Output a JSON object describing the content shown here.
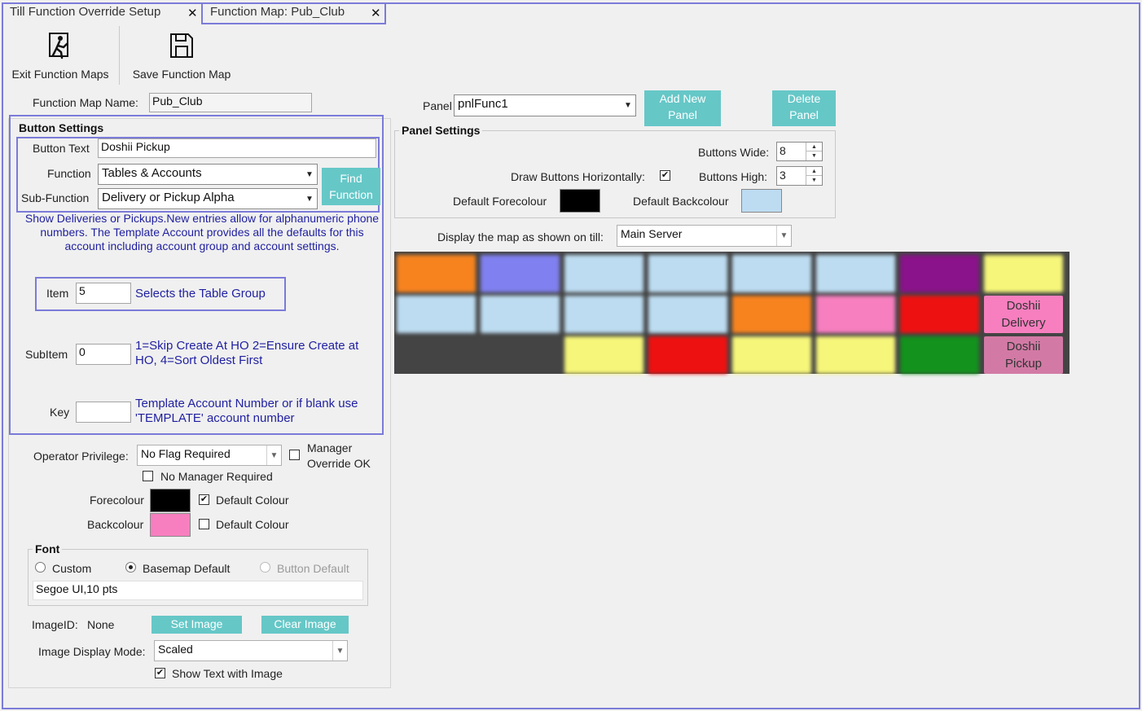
{
  "tabs": [
    {
      "label": "Till Function Override Setup",
      "close": "✕"
    },
    {
      "label": "Function Map: Pub_Club",
      "close": "✕"
    }
  ],
  "toolbar": {
    "exit_label": "Exit Function Maps",
    "save_label": "Save Function Map"
  },
  "function_map": {
    "name_label": "Function Map Name:",
    "name_value": "Pub_Club"
  },
  "button_settings": {
    "title": "Button Settings",
    "button_text_label": "Button Text",
    "button_text_value": "Doshii Pickup",
    "function_label": "Function",
    "function_value": "Tables & Accounts",
    "subfunction_label": "Sub-Function",
    "subfunction_value": "Delivery or Pickup Alpha",
    "find_function_label": "Find Function",
    "description": "Show Deliveries or Pickups.New entries allow for alphanumeric phone numbers. The Template Account provides all the defaults for this account including account group and account settings.",
    "item_label": "Item",
    "item_value": "5",
    "item_hint": "Selects the Table Group",
    "subitem_label": "SubItem",
    "subitem_value": "0",
    "subitem_hint": "1=Skip Create At HO 2=Ensure Create at HO, 4=Sort Oldest First",
    "key_label": "Key",
    "key_value": "",
    "key_hint": "Template Account Number or if blank use 'TEMPLATE' account number"
  },
  "privilege": {
    "operator_label": "Operator Privilege:",
    "operator_value": "No Flag Required",
    "manager_override_label": "Manager Override OK",
    "manager_override_checked": false,
    "no_manager_label": "No Manager Required",
    "no_manager_checked": false
  },
  "colours": {
    "fore_label": "Forecolour",
    "fore_color": "#000000",
    "fore_default_label": "Default Colour",
    "fore_default_checked": true,
    "back_label": "Backcolour",
    "back_color": "#f77fbf",
    "back_default_label": "Default Colour",
    "back_default_checked": false
  },
  "font": {
    "title": "Font",
    "options": [
      "Custom",
      "Basemap Default",
      "Button Default"
    ],
    "selected": "Basemap Default",
    "value": "Segoe UI,10 pts"
  },
  "image": {
    "id_label": "ImageID:",
    "id_value": "None",
    "set_label": "Set Image",
    "clear_label": "Clear Image",
    "display_mode_label": "Image Display Mode:",
    "display_mode_value": "Scaled",
    "show_text_label": "Show Text with Image",
    "show_text_checked": true
  },
  "panel": {
    "label": "Panel",
    "value": "pnlFunc1",
    "add_label": "Add New Panel",
    "delete_label": "Delete Panel"
  },
  "panel_settings": {
    "title": "Panel Settings",
    "buttons_wide_label": "Buttons Wide:",
    "buttons_wide_value": "8",
    "draw_horizontal_label": "Draw Buttons Horizontally:",
    "draw_horizontal_checked": true,
    "buttons_high_label": "Buttons High:",
    "buttons_high_value": "3",
    "default_fore_label": "Default Forecolour",
    "default_fore_color": "#000000",
    "default_back_label": "Default Backcolour",
    "default_back_color": "#bddcf1"
  },
  "display_map": {
    "label": "Display the map as shown on till:",
    "value": "Main Server"
  },
  "map_buttons": [
    [
      {
        "color": "#f7831f",
        "blurred": true
      },
      {
        "color": "#8080f0",
        "blurred": true
      },
      {
        "color": "#bddcf1",
        "blurred": true
      },
      {
        "color": "#bddcf1",
        "blurred": true
      },
      {
        "color": "#bddcf1",
        "blurred": true
      },
      {
        "color": "#bddcf1",
        "blurred": true
      },
      {
        "color": "#8a128a",
        "blurred": true
      },
      {
        "color": "#f6f67a",
        "blurred": true
      }
    ],
    [
      {
        "color": "#bddcf1",
        "blurred": true
      },
      {
        "color": "#bddcf1",
        "blurred": true
      },
      {
        "color": "#bddcf1",
        "blurred": true
      },
      {
        "color": "#bddcf1",
        "blurred": true
      },
      {
        "color": "#f7831f",
        "blurred": true
      },
      {
        "color": "#f77fbf",
        "blurred": true
      },
      {
        "color": "#ee1111",
        "blurred": true
      },
      {
        "color": "#f77fbf",
        "blurred": false,
        "label": "Doshii Delivery"
      }
    ],
    [
      {
        "color": "#444444",
        "blurred": false,
        "empty": true
      },
      {
        "color": "#444444",
        "blurred": false,
        "empty": true
      },
      {
        "color": "#f6f67a",
        "blurred": true
      },
      {
        "color": "#ee1111",
        "blurred": true
      },
      {
        "color": "#f6f67a",
        "blurred": true
      },
      {
        "color": "#f6f67a",
        "blurred": true
      },
      {
        "color": "#13921d",
        "blurred": true
      },
      {
        "color": "#d27aa5",
        "blurred": false,
        "label": "Doshii Pickup"
      }
    ]
  ]
}
